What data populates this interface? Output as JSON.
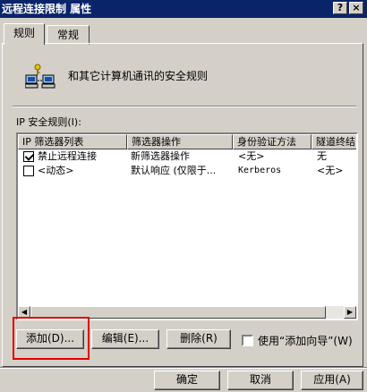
{
  "window": {
    "title": "远程连接限制 属性",
    "help_label": "?",
    "close_label": "×"
  },
  "tabs": [
    {
      "label": "规则"
    },
    {
      "label": "常规"
    }
  ],
  "header": {
    "text": "和其它计算机通讯的安全规则"
  },
  "rules": {
    "label": "IP 安全规则(I):",
    "columns": [
      "IP 筛选器列表",
      "筛选器操作",
      "身份验证方法",
      "隧道终结"
    ],
    "rows": [
      {
        "checked": true,
        "filter_list": "禁止远程连接",
        "filter_action": "新筛选器操作",
        "auth": "<无>",
        "tunnel": "无"
      },
      {
        "checked": false,
        "filter_list": "<动态>",
        "filter_action": "默认响应 (仅限于...",
        "auth": "Kerberos",
        "tunnel": "<无>"
      }
    ]
  },
  "scroll": {
    "left_arrow": "◀",
    "right_arrow": "▶"
  },
  "actions": {
    "add": "添加(D)...",
    "edit": "编辑(E)...",
    "remove": "删除(R)",
    "use_wizard": {
      "checked": false,
      "label": "使用“添加向导”(W)"
    }
  },
  "footer": {
    "ok": "确定",
    "cancel": "取消",
    "apply": "应用(A)"
  }
}
